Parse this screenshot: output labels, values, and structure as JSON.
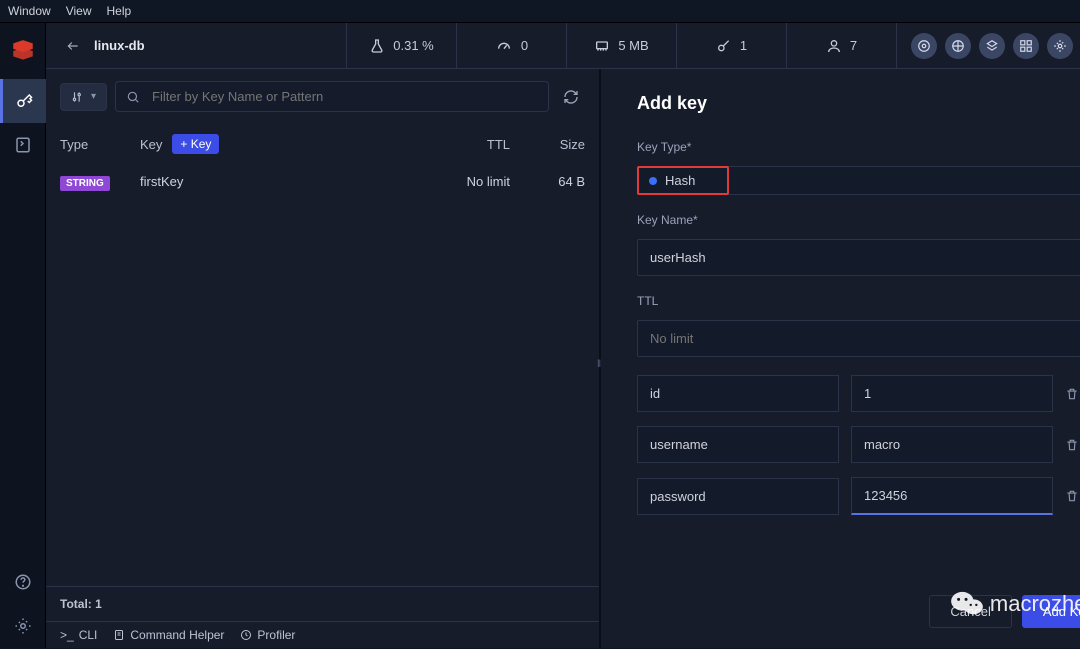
{
  "menubar": {
    "window": "Window",
    "view": "View",
    "help": "Help"
  },
  "topbar": {
    "db_name": "linux-db",
    "stats": {
      "cpu": "0.31 %",
      "latency": "0",
      "memory": "5 MB",
      "keys": "1",
      "users": "7"
    }
  },
  "filter": {
    "placeholder": "Filter by Key Name or Pattern"
  },
  "columns": {
    "type": "Type",
    "key": "Key",
    "addkey": "+ Key",
    "ttl": "TTL",
    "size": "Size"
  },
  "rows": [
    {
      "type_badge": "STRING",
      "key": "firstKey",
      "ttl": "No limit",
      "size": "64 B"
    }
  ],
  "footer": {
    "total_label": "Total:",
    "total_value": "1"
  },
  "tabs": {
    "cli": "CLI",
    "helper": "Command Helper",
    "profiler": "Profiler"
  },
  "panel": {
    "title": "Add key",
    "key_type_label": "Key Type*",
    "key_type_value": "Hash",
    "key_name_label": "Key Name*",
    "key_name_value": "userHash",
    "ttl_label": "TTL",
    "ttl_placeholder": "No limit",
    "fields": [
      {
        "k": "id",
        "v": "1"
      },
      {
        "k": "username",
        "v": "macro"
      },
      {
        "k": "password",
        "v": "123456"
      }
    ],
    "cancel": "Cancel",
    "submit": "Add Key"
  },
  "watermark": "macrozheng"
}
